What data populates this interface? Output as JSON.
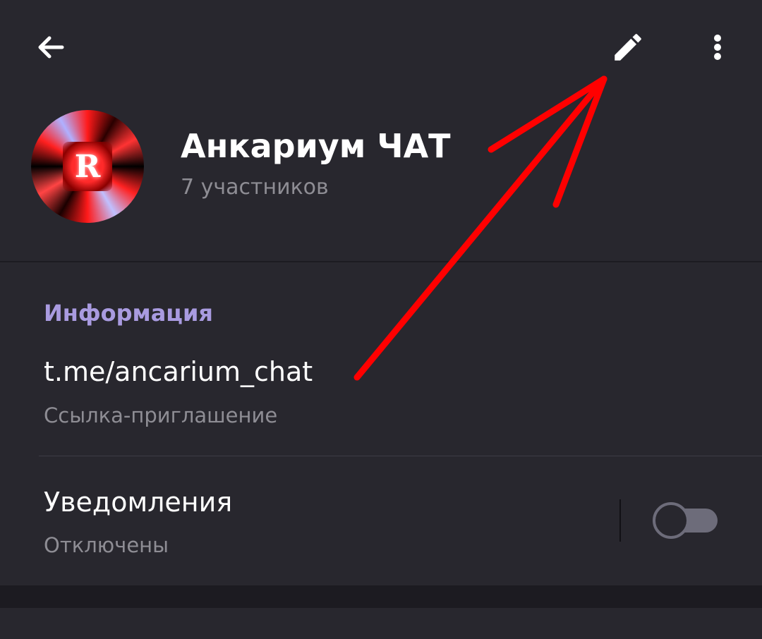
{
  "toolbar": {
    "back_icon": "arrow-left-icon",
    "edit_icon": "pencil-icon",
    "more_icon": "more-vertical-icon"
  },
  "chat": {
    "title": "Анкариум ЧАТ",
    "members": "7 участников",
    "avatar_letter": "R"
  },
  "info": {
    "section_title": "Информация",
    "link": "t.me/ancarium_chat",
    "link_caption": "Ссылка-приглашение",
    "notifications_label": "Уведомления",
    "notifications_status": "Отключены",
    "notifications_enabled": false
  },
  "colors": {
    "background": "#1c1b21",
    "surface": "#28272e",
    "accent": "#a99be0",
    "secondary_text": "#8e8d94",
    "annotation_arrow": "#ff0000"
  }
}
